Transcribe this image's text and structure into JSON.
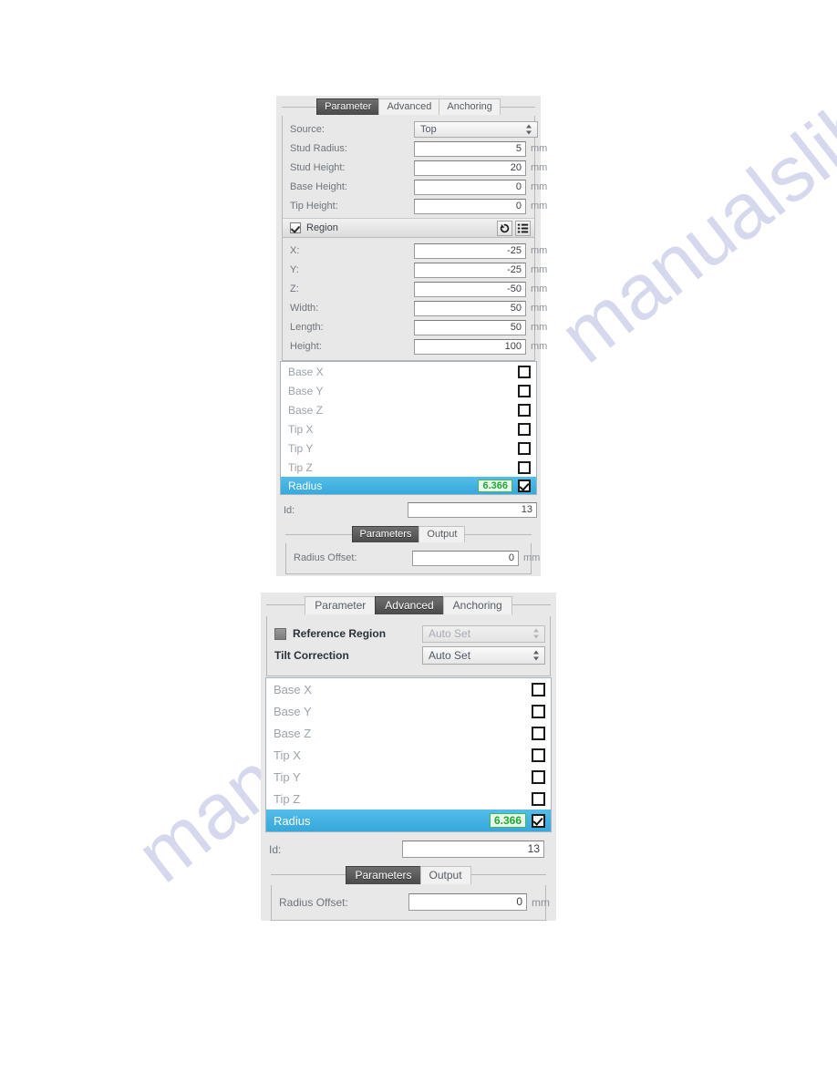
{
  "watermark": {
    "text_right": "manualslib.com",
    "text_left": "manualslib"
  },
  "panel_top": {
    "tabs": [
      {
        "label": "Parameter",
        "active": true
      },
      {
        "label": "Advanced",
        "active": false
      },
      {
        "label": "Anchoring",
        "active": false
      }
    ],
    "source": {
      "label": "Source:",
      "value": "Top"
    },
    "fields": [
      {
        "label": "Stud Radius:",
        "value": "5",
        "unit": "mm"
      },
      {
        "label": "Stud Height:",
        "value": "20",
        "unit": "mm"
      },
      {
        "label": "Base Height:",
        "value": "0",
        "unit": "mm"
      },
      {
        "label": "Tip Height:",
        "value": "0",
        "unit": "mm"
      }
    ],
    "region": {
      "label": "Region",
      "checked": true,
      "reset_icon": "reset-icon",
      "list_icon": "list-icon"
    },
    "region_fields": [
      {
        "label": "X:",
        "value": "-25",
        "unit": "mm"
      },
      {
        "label": "Y:",
        "value": "-25",
        "unit": "mm"
      },
      {
        "label": "Z:",
        "value": "-50",
        "unit": "mm"
      },
      {
        "label": "Width:",
        "value": "50",
        "unit": "mm"
      },
      {
        "label": "Length:",
        "value": "50",
        "unit": "mm"
      },
      {
        "label": "Height:",
        "value": "100",
        "unit": "mm"
      }
    ],
    "param_list": [
      {
        "name": "Base X",
        "value": "",
        "checked": false,
        "selected": false
      },
      {
        "name": "Base Y",
        "value": "",
        "checked": false,
        "selected": false
      },
      {
        "name": "Base Z",
        "value": "",
        "checked": false,
        "selected": false
      },
      {
        "name": "Tip X",
        "value": "",
        "checked": false,
        "selected": false
      },
      {
        "name": "Tip Y",
        "value": "",
        "checked": false,
        "selected": false
      },
      {
        "name": "Tip Z",
        "value": "",
        "checked": false,
        "selected": false
      },
      {
        "name": "Radius",
        "value": "6.366",
        "checked": true,
        "selected": true
      }
    ],
    "id": {
      "label": "Id:",
      "value": "13"
    },
    "subtabs": [
      {
        "label": "Parameters",
        "active": true
      },
      {
        "label": "Output",
        "active": false
      }
    ],
    "radius_offset": {
      "label": "Radius Offset:",
      "value": "0",
      "unit": "mm"
    }
  },
  "panel_bottom": {
    "tabs": [
      {
        "label": "Parameter",
        "active": false
      },
      {
        "label": "Advanced",
        "active": true
      },
      {
        "label": "Anchoring",
        "active": false
      }
    ],
    "reference_region": {
      "label": "Reference Region",
      "checked": false,
      "value": "Auto Set",
      "disabled": true
    },
    "tilt_correction": {
      "label": "Tilt Correction",
      "value": "Auto Set",
      "disabled": false
    },
    "param_list": [
      {
        "name": "Base X",
        "value": "",
        "checked": false,
        "selected": false
      },
      {
        "name": "Base Y",
        "value": "",
        "checked": false,
        "selected": false
      },
      {
        "name": "Base Z",
        "value": "",
        "checked": false,
        "selected": false
      },
      {
        "name": "Tip X",
        "value": "",
        "checked": false,
        "selected": false
      },
      {
        "name": "Tip Y",
        "value": "",
        "checked": false,
        "selected": false
      },
      {
        "name": "Tip Z",
        "value": "",
        "checked": false,
        "selected": false
      },
      {
        "name": "Radius",
        "value": "6.366",
        "checked": true,
        "selected": true
      }
    ],
    "id": {
      "label": "Id:",
      "value": "13"
    },
    "subtabs": [
      {
        "label": "Parameters",
        "active": true
      },
      {
        "label": "Output",
        "active": false
      }
    ],
    "radius_offset": {
      "label": "Radius Offset:",
      "value": "0",
      "unit": "mm"
    }
  },
  "colors": {
    "selection_blue": "#35a8dc",
    "value_green": "#1faa32",
    "panel_gray": "#e8e8e8",
    "tab_active": "#4a4a4a"
  }
}
